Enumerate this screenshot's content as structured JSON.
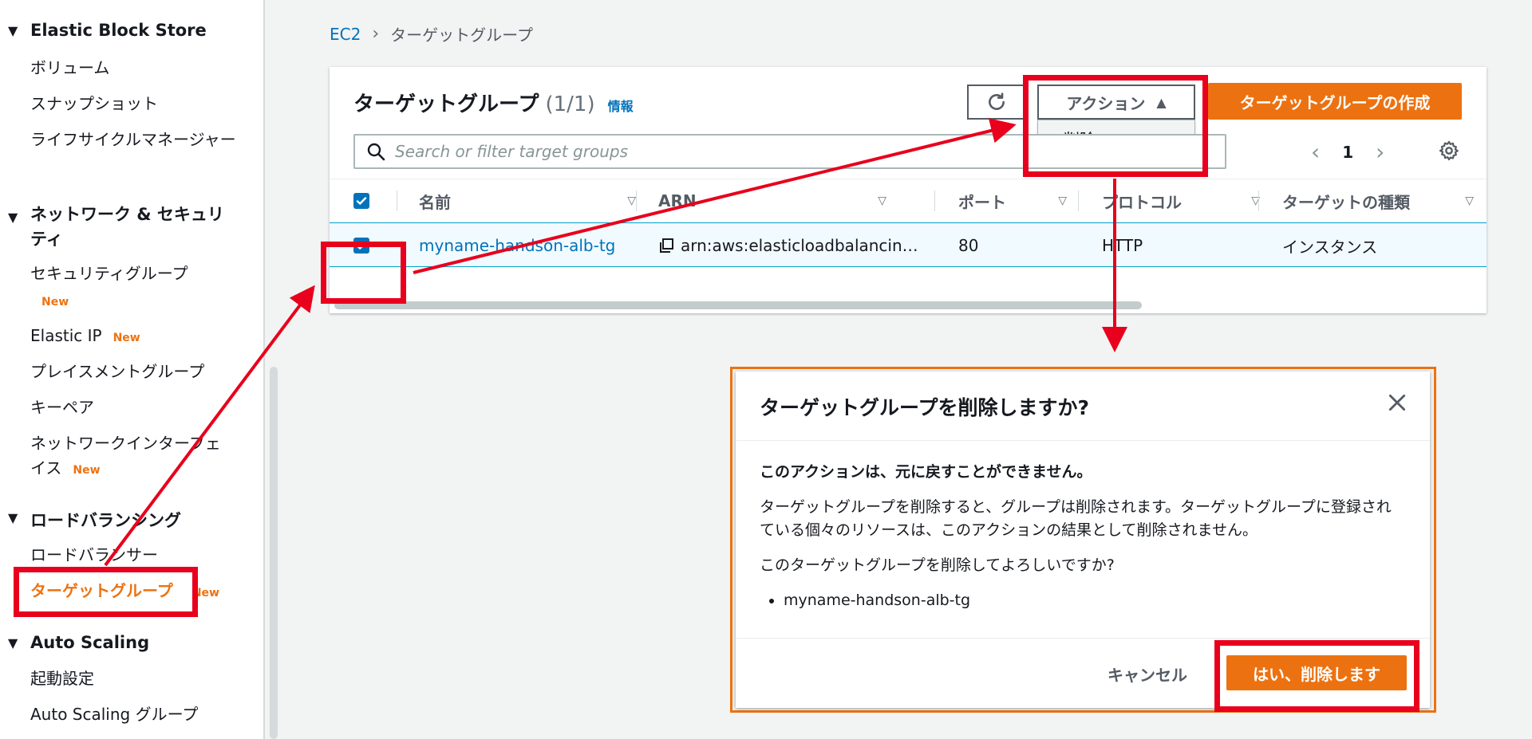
{
  "sidebar": {
    "sections": [
      {
        "label": "Elastic Block Store"
      },
      {
        "label": "ネットワーク & セキュリティ"
      },
      {
        "label": "ロードバランシング"
      },
      {
        "label": "Auto Scaling"
      }
    ],
    "ebs_items": [
      "ボリューム",
      "スナップショット",
      "ライフサイクルマネージャー"
    ],
    "network_items": [
      "セキュリティグループ",
      "Elastic IP",
      "プレイスメントグループ",
      "キーペア",
      "ネットワークインターフェイス"
    ],
    "lb_items": [
      "ロードバランサー",
      "ターゲットグループ"
    ],
    "as_items": [
      "起動設定",
      "Auto Scaling グループ"
    ],
    "new_badge": "New"
  },
  "breadcrumb": {
    "root": "EC2",
    "current": "ターゲットグループ"
  },
  "panel": {
    "title": "ターゲットグループ",
    "count": "(1/1)",
    "info": "情報",
    "actions_label": "アクション",
    "actions_menu": [
      "削除"
    ],
    "create_label": "ターゲットグループの作成",
    "search_placeholder": "Search or filter target groups",
    "page": "1"
  },
  "table": {
    "columns": [
      "名前",
      "ARN",
      "ポート",
      "プロトコル",
      "ターゲットの種類"
    ],
    "rows": [
      {
        "name": "myname-handson-alb-tg",
        "arn": "arn:aws:elasticloadbalancin…",
        "port": "80",
        "protocol": "HTTP",
        "type": "インスタンス",
        "selected": true
      }
    ]
  },
  "modal": {
    "title": "ターゲットグループを削除しますか?",
    "warning": "このアクションは、元に戻すことができません。",
    "description": "ターゲットグループを削除すると、グループは削除されます。ターゲットグループに登録されている個々のリソースは、このアクションの結果として削除されません。",
    "question": "このターゲットグループを削除してよろしいですか?",
    "items": [
      "myname-handson-alb-tg"
    ],
    "cancel_label": "キャンセル",
    "confirm_label": "はい、削除します"
  },
  "colors": {
    "accent": "#ec7211",
    "link": "#0073bb",
    "annotation": "#e8001c"
  }
}
